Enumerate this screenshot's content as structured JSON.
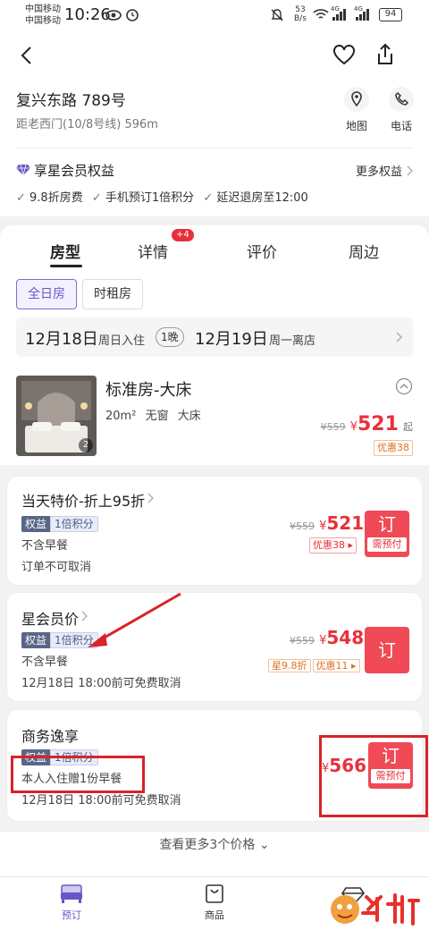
{
  "status_bar": {
    "carrier1": "中国移动",
    "carrier2": "中国移动",
    "time": "10:26",
    "net_speed_top": "53",
    "net_speed_bottom": "B/s",
    "signal1": "4G",
    "signal2": "4G",
    "battery": "94"
  },
  "hotel": {
    "address": "复兴东路 789号",
    "distance": "距老西门(10/8号线) 596m",
    "map_label": "地图",
    "phone_label": "电话"
  },
  "member": {
    "title": "享星会员权益",
    "more": "更多权益",
    "perks": [
      "9.8折房费",
      "手机预订1倍积分",
      "延迟退房至12:00"
    ]
  },
  "tabs": [
    {
      "label": "房型"
    },
    {
      "label": "详情",
      "badge": "+4"
    },
    {
      "label": "评价"
    },
    {
      "label": "周边"
    }
  ],
  "room_types": [
    "全日房",
    "时租房"
  ],
  "dates": {
    "checkin_date": "12月18日",
    "checkin_label": "周日入住",
    "nights": "1晚",
    "checkout_date": "12月19日",
    "checkout_label": "周一离店"
  },
  "room": {
    "name": "标准房-大床",
    "area": "20m²",
    "window": "无窗",
    "bed": "大床",
    "photo_count": "2",
    "orig_price": "¥559",
    "currency": "¥",
    "price": "521",
    "from": "起",
    "discount": "优惠38"
  },
  "rates": [
    {
      "name": "当天特价-折上95折",
      "badge_left": "权益",
      "badge_right": "1倍积分",
      "line1": "不含早餐",
      "line2": "订单不可取消",
      "orig": "¥559",
      "currency": "¥",
      "price": "521",
      "tag": "优惠38 ▸",
      "book": "订",
      "prepay": "需预付"
    },
    {
      "name": "星会员价",
      "badge_left": "权益",
      "badge_right": "1倍积分",
      "line1": "不含早餐",
      "line2": "12月18日 18:00前可免费取消",
      "orig": "¥559",
      "currency": "¥",
      "price": "548",
      "tag_a": "星9.8折",
      "tag_b": "优惠11 ▸",
      "book": "订"
    },
    {
      "name": "商务逸享",
      "badge_left": "权益",
      "badge_right": "1倍积分",
      "line1": "本人入住赠1份早餐",
      "line2": "12月18日 18:00前可免费取消",
      "currency": "¥",
      "price": "566",
      "book": "订",
      "prepay": "需预付"
    }
  ],
  "more_prices": "查看更多3个价格",
  "bottom_nav": [
    {
      "label": "预订",
      "icon": "bed-icon"
    },
    {
      "label": "商品",
      "icon": "bag-icon"
    },
    {
      "label": "",
      "icon": "diamond-icon"
    }
  ],
  "colors": {
    "accent_red": "#e8303b",
    "purple": "#6a55c8",
    "annotation_red": "#d8232a"
  }
}
